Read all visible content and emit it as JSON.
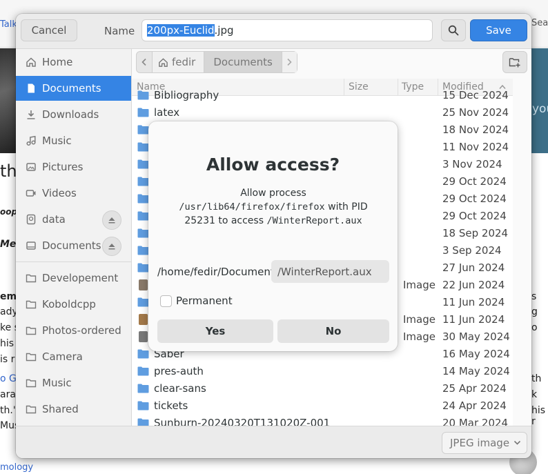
{
  "background": {
    "talk_link": "Talk",
    "search_text": "Sear",
    "photo_overlay_text": "you",
    "left_fragments": [
      "the",
      "oop",
      "Mer",
      "'",
      "ema",
      "ady",
      "ke s",
      "his",
      "is r",
      "o Ga",
      "arac",
      "th.'",
      "Mus"
    ],
    "right_fragments": [
      "s",
      "g",
      "o",
      "th",
      "k",
      "his r"
    ],
    "bottom_link": "mology"
  },
  "dialog": {
    "cancel_label": "Cancel",
    "name_label": "Name",
    "filename_selected": "200px-Euclid",
    "filename_ext": ".jpg",
    "save_label": "Save",
    "search_icon": "search-icon",
    "sidebar": {
      "items": [
        {
          "label": "Home",
          "icon": "home-icon"
        },
        {
          "label": "Documents",
          "icon": "document-icon",
          "active": true
        },
        {
          "label": "Downloads",
          "icon": "download-icon"
        },
        {
          "label": "Music",
          "icon": "music-icon"
        },
        {
          "label": "Pictures",
          "icon": "picture-icon"
        },
        {
          "label": "Videos",
          "icon": "video-icon"
        },
        {
          "label": "data",
          "icon": "drive-icon",
          "eject": true
        },
        {
          "label": "Documents",
          "icon": "drive-icon",
          "eject": true
        }
      ],
      "bookmarks": [
        {
          "label": "Developement"
        },
        {
          "label": "Koboldcpp"
        },
        {
          "label": "Photos-ordered"
        },
        {
          "label": "Camera"
        },
        {
          "label": "Music"
        },
        {
          "label": "Shared"
        }
      ]
    },
    "pathbar": {
      "home": "fedir",
      "current": "Documents"
    },
    "columns": {
      "name": "Name",
      "size": "Size",
      "type": "Type",
      "modified": "Modified"
    },
    "files": [
      {
        "name": "Bibliography",
        "type": "",
        "modified": "15 Dec 2024",
        "kind": "folder"
      },
      {
        "name": "latex",
        "type": "",
        "modified": "25 Nov 2024",
        "kind": "folder"
      },
      {
        "name": "",
        "type": "",
        "modified": "18 Nov 2024",
        "kind": "folder"
      },
      {
        "name": "",
        "type": "",
        "modified": "11 Nov 2024",
        "kind": "folder"
      },
      {
        "name": "",
        "type": "",
        "modified": "3 Nov 2024",
        "kind": "folder"
      },
      {
        "name": "",
        "type": "",
        "modified": "29 Oct 2024",
        "kind": "folder"
      },
      {
        "name": "",
        "type": "",
        "modified": "29 Oct 2024",
        "kind": "folder"
      },
      {
        "name": "",
        "type": "",
        "modified": "29 Oct 2024",
        "kind": "folder"
      },
      {
        "name": "",
        "type": "",
        "modified": "18 Sep 2024",
        "kind": "folder"
      },
      {
        "name": "",
        "type": "",
        "modified": "3 Sep 2024",
        "kind": "folder"
      },
      {
        "name": "",
        "type": "",
        "modified": "27 Jun 2024",
        "kind": "folder"
      },
      {
        "name": "",
        "type": "Image",
        "modified": "22 Jun 2024",
        "kind": "image",
        "thumb_color": "#8a7a6a"
      },
      {
        "name": "",
        "type": "",
        "modified": "11 Jun 2024",
        "kind": "folder"
      },
      {
        "name": "",
        "type": "Image",
        "modified": "11 Jun 2024",
        "kind": "image",
        "thumb_color": "#a3794a"
      },
      {
        "name": "",
        "type": "Image",
        "modified": "30 May 2024",
        "kind": "image",
        "thumb_color": "#7a7a7a"
      },
      {
        "name": "Saber",
        "type": "",
        "modified": "16 May 2024",
        "kind": "folder"
      },
      {
        "name": "pres-auth",
        "type": "",
        "modified": "14 May 2024",
        "kind": "folder"
      },
      {
        "name": "clear-sans",
        "type": "",
        "modified": "25 Apr 2024",
        "kind": "folder"
      },
      {
        "name": "tickets",
        "type": "",
        "modified": "24 Apr 2024",
        "kind": "folder"
      },
      {
        "name": "Sunburn-20240320T131020Z-001",
        "type": "",
        "modified": "20 Mar 2024",
        "kind": "folder"
      }
    ],
    "filter_label": "JPEG image"
  },
  "modal": {
    "title": "Allow access?",
    "body_prefix": "Allow process ",
    "process_path": "/usr/lib64/firefox/firefox",
    "body_middle": " with PID 25231 to access ",
    "target_path": "/WinterReport.aux",
    "path_prefix": "/home/fedir/Documents",
    "path_entry": "/WinterReport.aux",
    "permanent_label": "Permanent",
    "yes_label": "Yes",
    "no_label": "No"
  },
  "colors": {
    "accent": "#3584e4",
    "folder": "#5f9de0"
  }
}
